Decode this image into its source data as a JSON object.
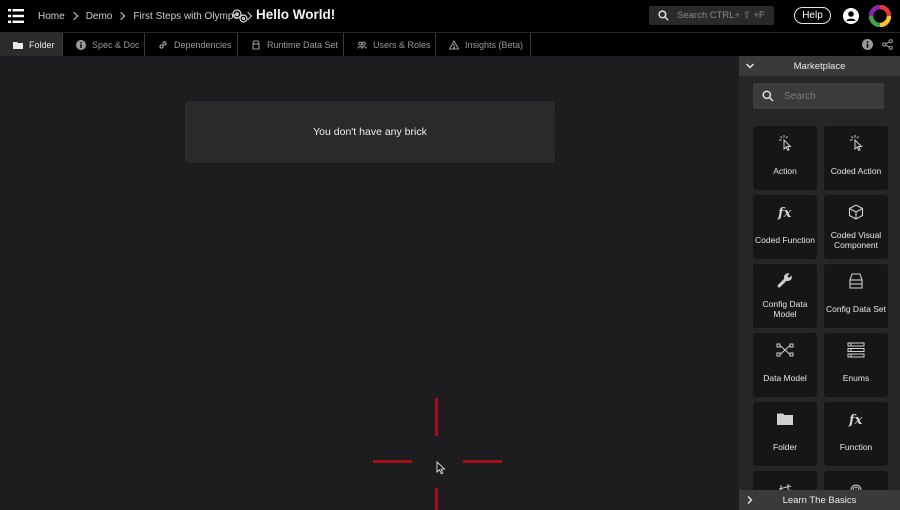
{
  "topbar": {
    "breadcrumb": [
      "Home",
      "Demo",
      "First Steps with Olympe"
    ],
    "title": "Hello World!",
    "search_placeholder": "Search CTRL+ ⇧ +F",
    "help_label": "Help"
  },
  "tabs": [
    {
      "label": "Folder",
      "icon": "folder-icon",
      "active": true
    },
    {
      "label": "Spec & Doc",
      "icon": "info-circle-icon",
      "active": false
    },
    {
      "label": "Dependencies",
      "icon": "link-icon",
      "active": false
    },
    {
      "label": "Runtime Data Set",
      "icon": "database-icon",
      "active": false
    },
    {
      "label": "Users & Roles",
      "icon": "users-icon",
      "active": false
    },
    {
      "label": "Insights (Beta)",
      "icon": "warning-icon",
      "active": false
    }
  ],
  "canvas": {
    "empty_message": "You don't have any brick",
    "accent_color": "#a3101c"
  },
  "marketplace": {
    "title": "Marketplace",
    "search_placeholder": "Search",
    "tiles": [
      {
        "label": "Action",
        "icon": "cursor-click-icon"
      },
      {
        "label": "Coded Action",
        "icon": "cursor-click-icon"
      },
      {
        "label": "Coded Function",
        "icon": "fx-icon"
      },
      {
        "label": "Coded Visual Component",
        "icon": "cube-icon"
      },
      {
        "label": "Config Data Model",
        "icon": "wrench-icon"
      },
      {
        "label": "Config Data Set",
        "icon": "tray-icon"
      },
      {
        "label": "Data Model",
        "icon": "nodes-icon"
      },
      {
        "label": "Enums",
        "icon": "list-icon"
      },
      {
        "label": "Folder",
        "icon": "folder-icon"
      },
      {
        "label": "Function",
        "icon": "fx-icon"
      },
      {
        "label": "",
        "icon": "partial-icon"
      },
      {
        "label": "",
        "icon": "partial-icon"
      }
    ],
    "footer_label": "Learn The Basics"
  }
}
